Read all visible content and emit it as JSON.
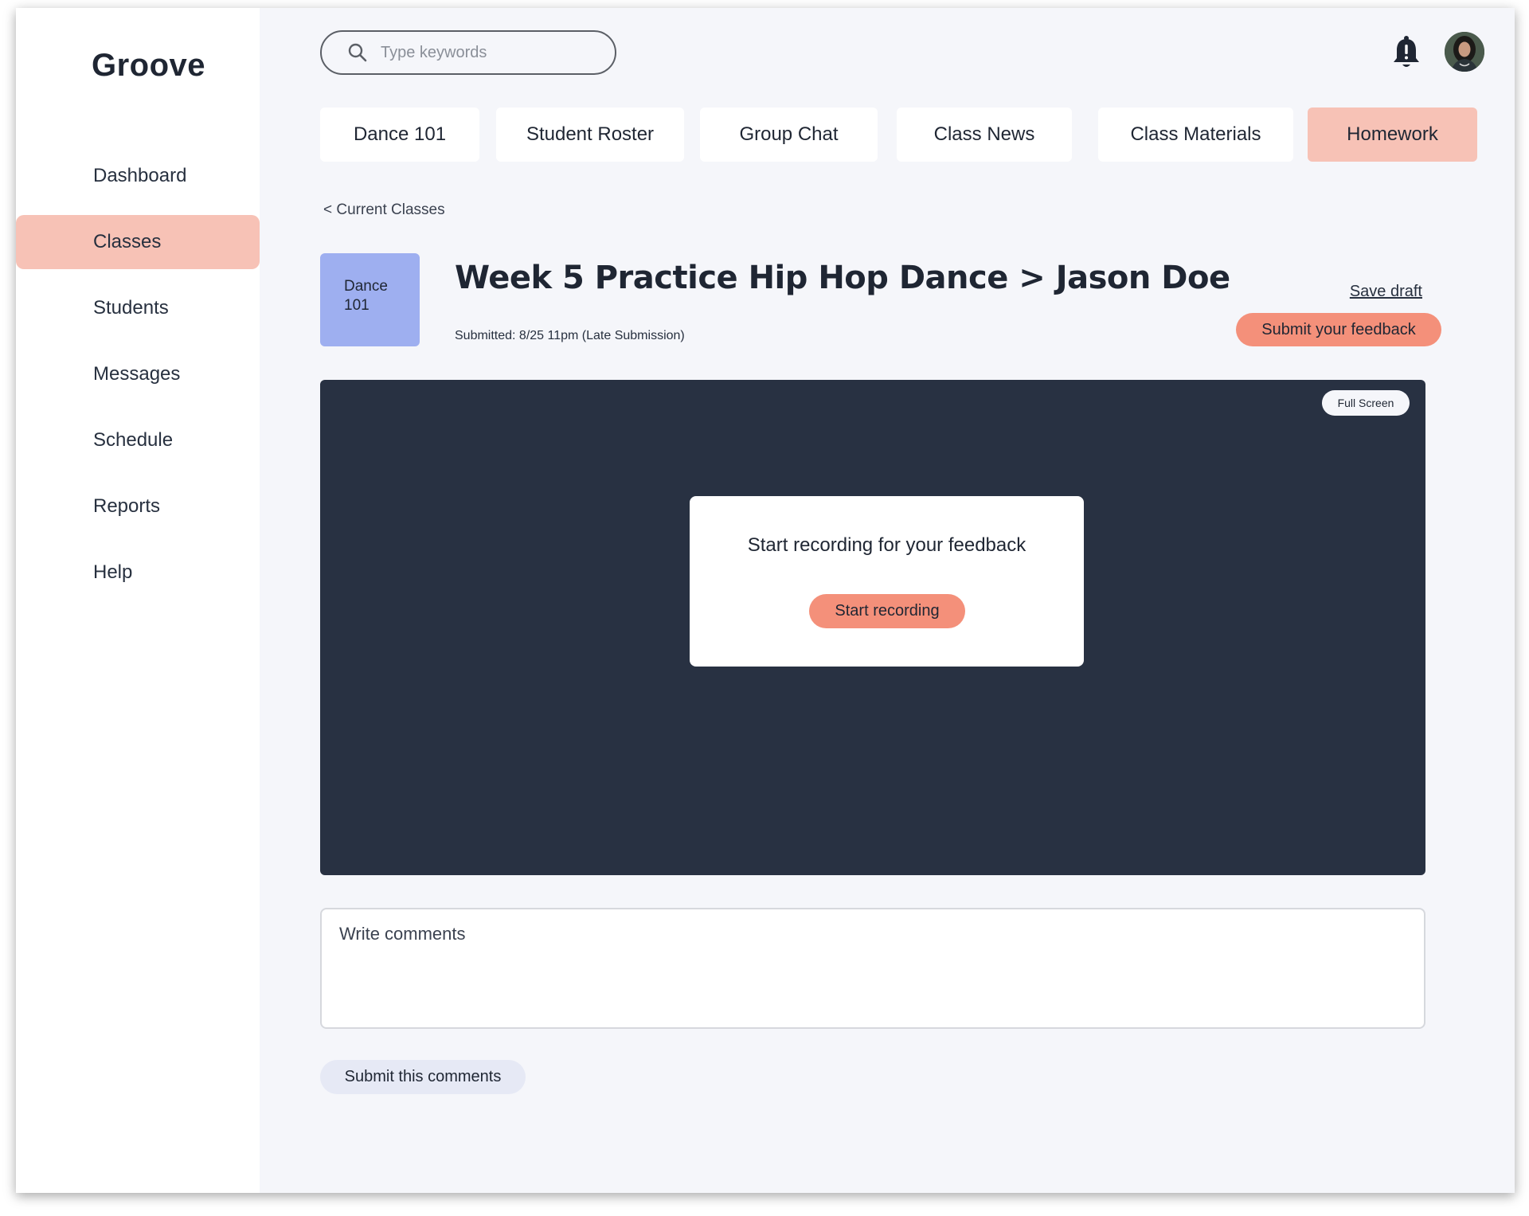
{
  "app": {
    "logo": "Groove"
  },
  "sidebar": {
    "items": [
      {
        "label": "Dashboard",
        "active": false
      },
      {
        "label": "Classes",
        "active": true
      },
      {
        "label": "Students",
        "active": false
      },
      {
        "label": "Messages",
        "active": false
      },
      {
        "label": "Schedule",
        "active": false
      },
      {
        "label": "Reports",
        "active": false
      },
      {
        "label": "Help",
        "active": false
      }
    ]
  },
  "header": {
    "search_placeholder": "Type keywords",
    "icons": [
      "search-icon",
      "bell-icon",
      "user-avatar"
    ]
  },
  "tabs": [
    {
      "label": "Dance 101",
      "active": false
    },
    {
      "label": "Student Roster",
      "active": false
    },
    {
      "label": "Group Chat",
      "active": false
    },
    {
      "label": "Class News",
      "active": false
    },
    {
      "label": "Class Materials",
      "active": false
    },
    {
      "label": "Homework",
      "active": true
    }
  ],
  "breadcrumb": "< Current Classes",
  "class_badge": {
    "line1": "Dance",
    "line2": "101"
  },
  "assignment": {
    "title": "Week 5 Practice Hip Hop Dance > Jason Doe",
    "submitted": "Submitted:  8/25 11pm  (Late Submission)"
  },
  "actions": {
    "save_draft": "Save draft",
    "submit_feedback": "Submit your feedback"
  },
  "video": {
    "fullscreen_label": "Full Screen",
    "prompt": "Start recording for your feedback",
    "record_button": "Start recording"
  },
  "comments": {
    "placeholder": "Write comments",
    "submit_label": "Submit this comments"
  },
  "colors": {
    "accent": "#f4907a",
    "active_bg": "#f7c2b6",
    "badge_bg": "#9eaff0",
    "video_bg": "#283142",
    "page_bg": "#f5f6fa"
  }
}
